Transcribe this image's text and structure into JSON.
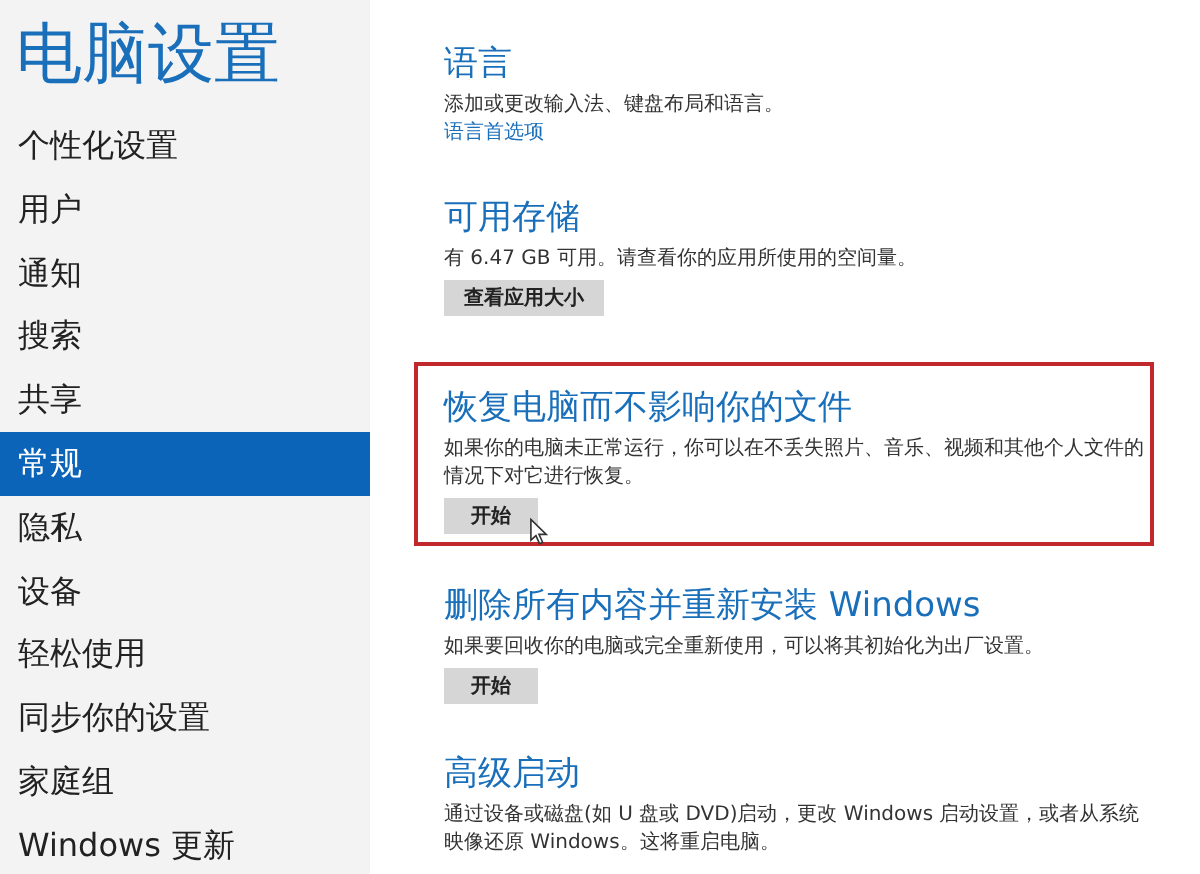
{
  "sidebar": {
    "title": "电脑设置",
    "items": [
      {
        "label": "个性化设置",
        "selected": false
      },
      {
        "label": "用户",
        "selected": false
      },
      {
        "label": "通知",
        "selected": false
      },
      {
        "label": "搜索",
        "selected": false
      },
      {
        "label": "共享",
        "selected": false
      },
      {
        "label": "常规",
        "selected": true
      },
      {
        "label": "隐私",
        "selected": false
      },
      {
        "label": "设备",
        "selected": false
      },
      {
        "label": "轻松使用",
        "selected": false
      },
      {
        "label": "同步你的设置",
        "selected": false
      },
      {
        "label": "家庭组",
        "selected": false
      },
      {
        "label": "Windows 更新",
        "selected": false
      }
    ]
  },
  "sections": [
    {
      "heading": "语言",
      "description": "添加或更改输入法、键盘布局和语言。",
      "link": "语言首选项"
    },
    {
      "heading": "可用存储",
      "description": "有 6.47 GB 可用。请查看你的应用所使用的空间量。",
      "button": "查看应用大小"
    },
    {
      "heading": "恢复电脑而不影响你的文件",
      "description": "如果你的电脑未正常运行，你可以在不丢失照片、音乐、视频和其他个人文件的情况下对它进行恢复。",
      "button": "开始",
      "highlighted": true,
      "pointer": true
    },
    {
      "heading": "删除所有内容并重新安装 Windows",
      "description": "如果要回收你的电脑或完全重新使用，可以将其初始化为出厂设置。",
      "button": "开始"
    },
    {
      "heading": "高级启动",
      "description": "通过设备或磁盘(如 U 盘或 DVD)启动，更改 Windows 启动设置，或者从系统映像还原 Windows。这将重启电脑。"
    }
  ]
}
